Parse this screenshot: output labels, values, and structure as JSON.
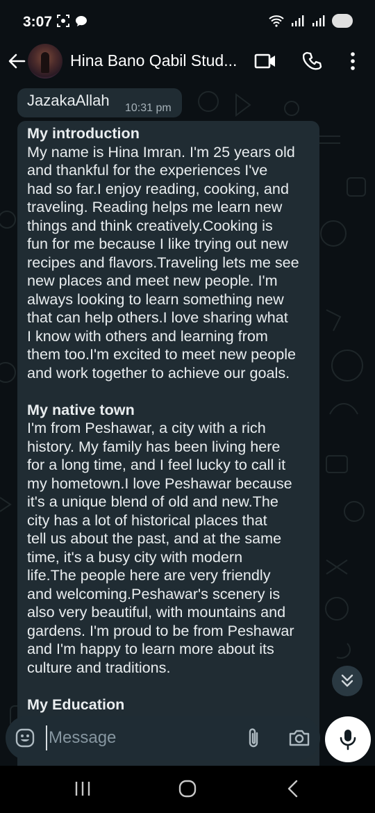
{
  "status_bar": {
    "time": "3:07"
  },
  "header": {
    "title": "Hina Bano Qabil Stud..."
  },
  "messages": [
    {
      "text": "JazakaAllah",
      "time": "10:31 pm"
    }
  ],
  "long_message": {
    "heading_intro": "My introduction",
    "lines_intro": [
      "My name is Hina Imran. I'm 25 years old",
      "and thankful for the experiences I've",
      "had so far.I enjoy reading, cooking, and",
      "traveling. Reading helps me learn new",
      "things and think creatively.Cooking is",
      "fun for me because I like trying out new",
      "recipes and flavors.Traveling lets me see",
      "new places and meet new people. I'm",
      "always looking to learn something new",
      "that can help others.I love sharing what",
      "I know with others and learning from",
      "them too.I'm excited to meet new people",
      "and work together to achieve our goals."
    ],
    "heading_town": "My native town",
    "lines_town": [
      "I'm from Peshawar, a city with a rich",
      "history. My family has been living here",
      "for a long time, and I feel lucky to call it",
      "my hometown.I love Peshawar because",
      "it's a unique blend of old and new.The",
      "city has a lot of historical places that",
      "tell us about the past, and at the same",
      "time, it's a busy city with modern",
      "life.The people here are very friendly",
      "and welcoming.Peshawar's scenery is",
      "also very beautiful, with mountains and",
      "gardens. I'm proud to be from Peshawar",
      "and I'm happy to learn more about its",
      "culture and traditions."
    ],
    "heading_education": "My Education"
  },
  "composer": {
    "placeholder": "Message"
  },
  "icons": {
    "back": "back-arrow-icon",
    "video": "video-call-icon",
    "call": "phone-icon",
    "menu": "more-vertical-icon",
    "emoji": "emoji-icon",
    "attach": "attach-icon",
    "camera": "camera-icon",
    "mic": "mic-icon",
    "scroll": "double-chevron-down-icon"
  },
  "colors": {
    "background": "#0b1014",
    "bubble": "#202c33",
    "composer": "#1f2c34",
    "text": "#e9edef",
    "meta": "#a6b2b9"
  }
}
